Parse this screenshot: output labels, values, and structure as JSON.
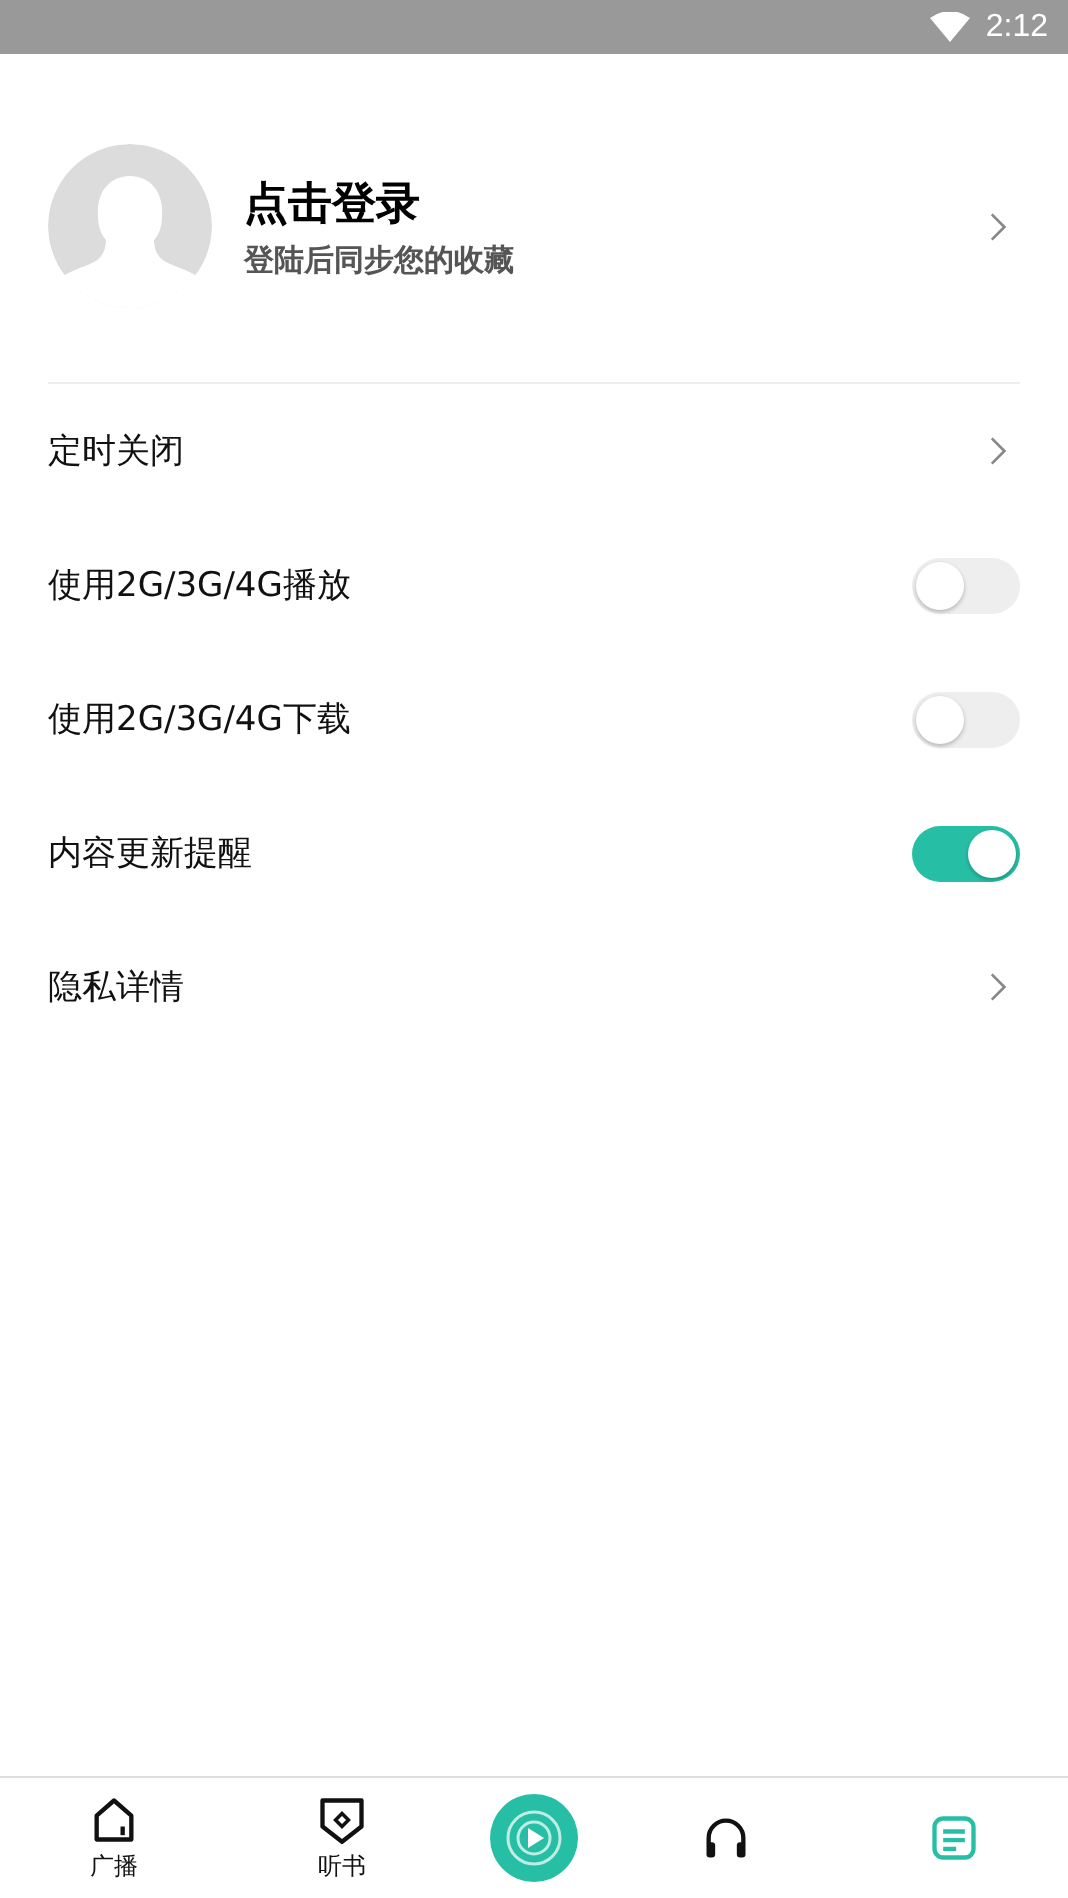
{
  "status_bar": {
    "time": "2:12"
  },
  "profile": {
    "title": "点击登录",
    "subtitle": "登陆后同步您的收藏"
  },
  "settings": [
    {
      "kind": "link",
      "label": "定时关闭"
    },
    {
      "kind": "toggle",
      "label": "使用2G/3G/4G播放",
      "on": false
    },
    {
      "kind": "toggle",
      "label": "使用2G/3G/4G下载",
      "on": false
    },
    {
      "kind": "toggle",
      "label": "内容更新提醒",
      "on": true
    },
    {
      "kind": "link",
      "label": "隐私详情"
    }
  ],
  "tabs": [
    {
      "kind": "home",
      "label": "广播",
      "selected": false
    },
    {
      "kind": "badge",
      "label": "听书",
      "selected": false
    },
    {
      "kind": "player",
      "selected": false
    },
    {
      "kind": "headphones",
      "selected": false
    },
    {
      "kind": "list",
      "selected": true
    }
  ]
}
